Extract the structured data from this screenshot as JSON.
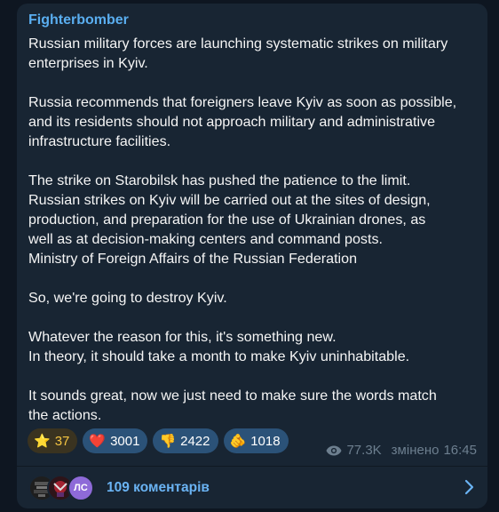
{
  "post": {
    "channel_name": "Fighterbomber",
    "paragraphs": [
      [
        "Russian military forces are launching systematic strikes on military",
        "enterprises in Kyiv."
      ],
      [
        "Russia recommends that foreigners leave Kyiv as soon as possible,",
        "and its residents should not approach military and administrative",
        "infrastructure facilities."
      ],
      [
        "The strike on Starobilsk has pushed the patience to the limit.",
        "Russian strikes on Kyiv will be carried out at the sites of design,",
        "production, and preparation for the use of Ukrainian drones, as",
        "well as at decision-making centers and command posts.",
        "Ministry of Foreign Affairs of the Russian Federation"
      ],
      [
        "So, we're going to destroy Kyiv."
      ],
      [
        "Whatever the reason for this, it's something new.",
        "In theory, it should take a month to make Kyiv uninhabitable."
      ],
      [
        "It sounds great, now we just need to make sure the words match",
        "the actions."
      ]
    ]
  },
  "reactions": [
    {
      "emoji": "⭐",
      "icon": "star-icon",
      "count": "37",
      "type": "paid"
    },
    {
      "emoji": "❤️",
      "icon": "heart-icon",
      "count": "3001",
      "type": "normal"
    },
    {
      "emoji": "👎",
      "icon": "thumbs-down-icon",
      "count": "2422",
      "type": "normal"
    },
    {
      "emoji": "🫵",
      "icon": "pointing-hand-icon",
      "count": "1018",
      "type": "normal"
    }
  ],
  "meta": {
    "views": "77.3K",
    "edited_label": "змінено",
    "time": "16:45"
  },
  "comments": {
    "label": "109 коментарів",
    "avatar_initials": "ЛС"
  },
  "colors": {
    "background": "#0e1621",
    "bubble": "#182533",
    "channel_name": "#5aaef0",
    "reaction_bg": "#2b5278",
    "link": "#6ab3f3"
  }
}
